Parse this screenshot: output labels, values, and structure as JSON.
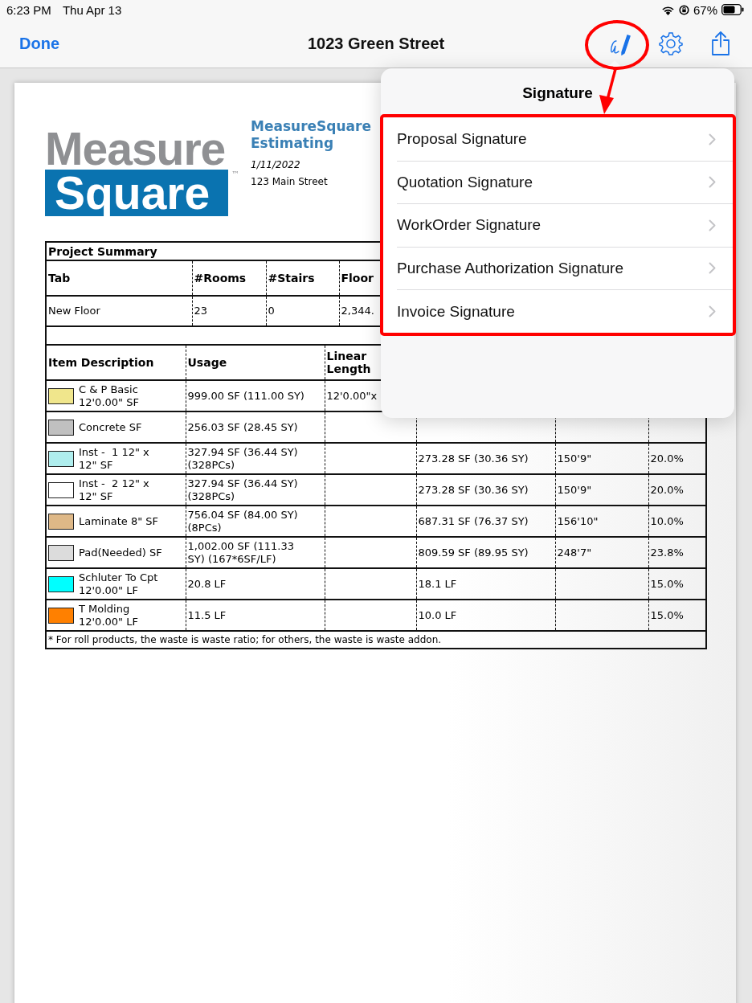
{
  "status_bar": {
    "time": "6:23 PM",
    "date": "Thu Apr 13",
    "battery": "67%"
  },
  "nav_bar": {
    "done": "Done",
    "title": "1023 Green Street"
  },
  "document": {
    "logo": {
      "top": "Measure",
      "bottom": "Square",
      "mark": "™"
    },
    "company": {
      "name": "MeasureSquare\nEstimating",
      "date": "1/11/2022",
      "address": "123 Main Street"
    },
    "summary": {
      "title": "Project Summary",
      "columns": [
        "Tab",
        "#Rooms",
        "#Stairs",
        "Floor"
      ],
      "rows": [
        [
          "New Floor",
          "23",
          "0",
          "2,344."
        ]
      ]
    },
    "items": {
      "columns": [
        "Item Description",
        "Usage",
        "Linear\nLength"
      ],
      "rows": [
        {
          "color": "#f0e68c",
          "description": "C & P Basic\n12'0.00\" SF",
          "usage": "999.00 SF (111.00 SY)",
          "linear_length": "12'0.00\"x",
          "column_4": "",
          "column_5": "",
          "column_6": ""
        },
        {
          "color": "#c0c0c0",
          "description": "Concrete SF",
          "usage": "256.03 SF (28.45 SY)",
          "linear_length": "",
          "column_4": "",
          "column_5": "",
          "column_6": ""
        },
        {
          "color": "#afeeee",
          "description": "Inst -  1 12\" x\n12\" SF",
          "usage": "327.94 SF (36.44 SY)\n(328PCs)",
          "linear_length": "",
          "column_4": "273.28 SF (30.36 SY)",
          "column_5": "150'9\"",
          "column_6": "20.0%"
        },
        {
          "color": "#ffffff",
          "description": "Inst -  2 12\" x\n12\" SF",
          "usage": "327.94 SF (36.44 SY)\n(328PCs)",
          "linear_length": "",
          "column_4": "273.28 SF (30.36 SY)",
          "column_5": "150'9\"",
          "column_6": "20.0%"
        },
        {
          "color": "#deb887",
          "description": "Laminate 8\" SF",
          "usage": "756.04 SF (84.00 SY)\n(8PCs)",
          "linear_length": "",
          "column_4": "687.31 SF (76.37 SY)",
          "column_5": "156'10\"",
          "column_6": "10.0%"
        },
        {
          "color": "#dcdcdc",
          "description": "Pad(Needed) SF",
          "usage": "1,002.00 SF (111.33\nSY) (167*6SF/LF)",
          "linear_length": "",
          "column_4": "809.59 SF (89.95 SY)",
          "column_5": "248'7\"",
          "column_6": "23.8%"
        },
        {
          "color": "#00ffff",
          "description": "Schluter To Cpt\n12'0.00\" LF",
          "usage": "20.8 LF",
          "linear_length": "",
          "column_4": "18.1 LF",
          "column_5": "",
          "column_6": "15.0%"
        },
        {
          "color": "#ff8000",
          "description": "T Molding\n12'0.00\" LF",
          "usage": "11.5 LF",
          "linear_length": "",
          "column_4": "10.0 LF",
          "column_5": "",
          "column_6": "15.0%"
        }
      ],
      "footnote": "* For roll products, the waste is waste ratio; for others, the waste is waste addon."
    }
  },
  "popover": {
    "title": "Signature",
    "items": [
      "Proposal Signature",
      "Quotation Signature",
      "WorkOrder Signature",
      "Purchase Authorization Signature",
      "Invoice Signature"
    ]
  }
}
